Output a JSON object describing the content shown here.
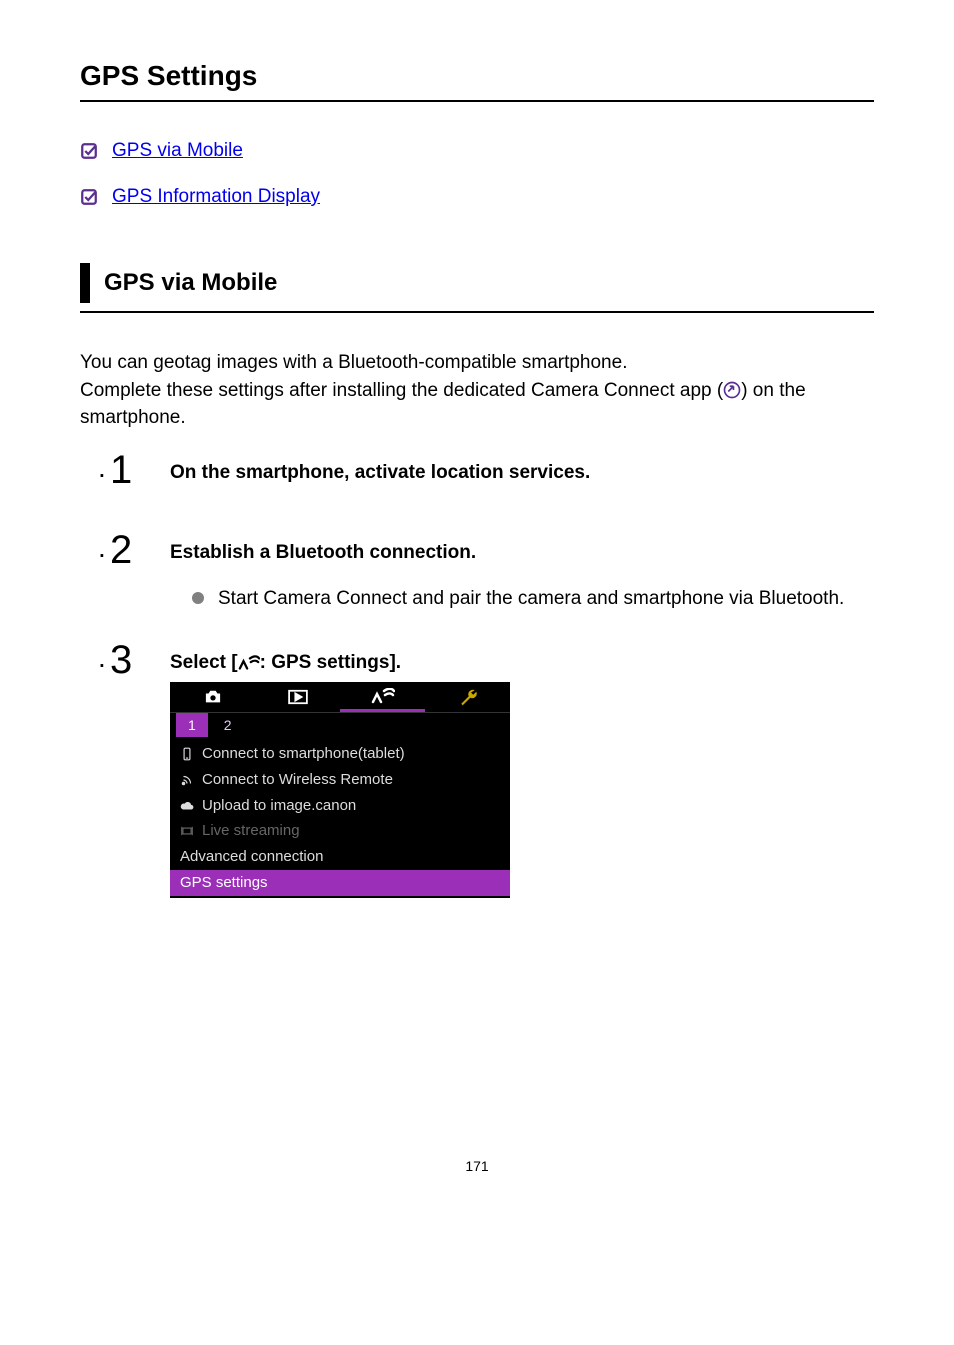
{
  "page_title": "GPS Settings",
  "toc": [
    {
      "label": "GPS via Mobile"
    },
    {
      "label": "GPS Information Display"
    }
  ],
  "section_title": "GPS via Mobile",
  "intro": {
    "line1": "You can geotag images with a Bluetooth-compatible smartphone.",
    "line2a": "Complete these settings after installing the dedicated Camera Connect app (",
    "line2b": ") on the smartphone."
  },
  "steps": {
    "s1": {
      "num": "1",
      "title": "On the smartphone, activate location services."
    },
    "s2": {
      "num": "2",
      "title": "Establish a Bluetooth connection.",
      "bullet": "Start Camera Connect and pair the camera and smartphone via Bluetooth."
    },
    "s3": {
      "num": "3",
      "title_prefix": "Select [",
      "title_suffix": ": GPS settings]."
    }
  },
  "cam_menu": {
    "subtabs": [
      "1",
      "2"
    ],
    "items": {
      "i0": "Connect to smartphone(tablet)",
      "i1": "Connect to Wireless Remote",
      "i2": "Upload to image.canon",
      "i3": "Live streaming",
      "i4": "Advanced connection",
      "i5": "GPS settings"
    }
  },
  "page_number": "171"
}
